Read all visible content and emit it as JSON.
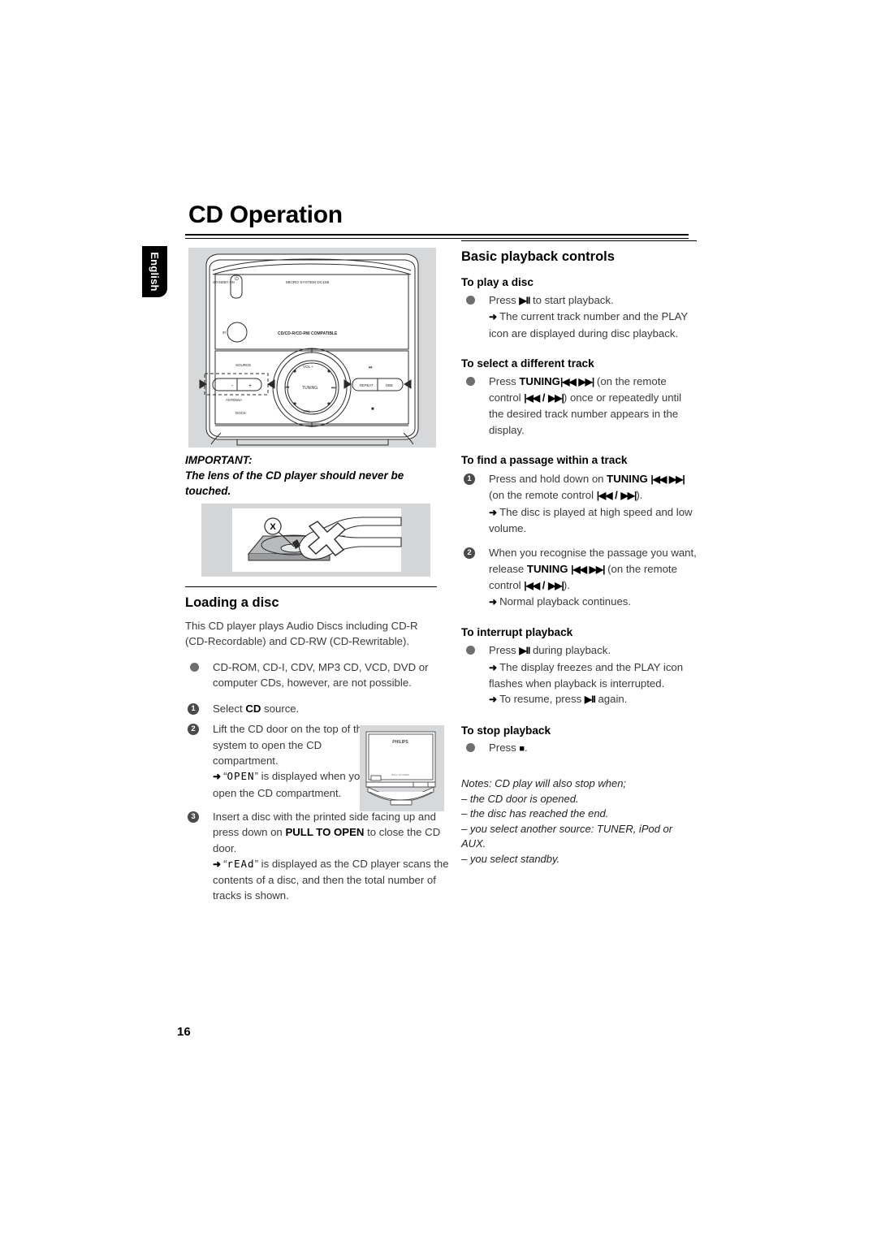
{
  "page": {
    "title": "CD Operation",
    "language_tab": "English",
    "number": "16"
  },
  "device_figure": {
    "name": "micro-system-top-panel",
    "labels": {
      "standby": "STANDBY ON",
      "model": "MICRO SYSTEM DC156",
      "compatible": "CD/CD-R/CD-RW COMPATIBLE",
      "ir": "IR",
      "source": "SOURCE",
      "antenna": "ANTENNA",
      "dock": "DOCK",
      "minus": "-",
      "plus": "+",
      "vol_up": "VOL +",
      "vol_down": "VOL -",
      "tuning": "TUNING",
      "prev": "|◀◀",
      "next": "▶▶|",
      "repeat": "REPEAT",
      "dbb": "DBB",
      "play_pause": "▶II",
      "stop": "■"
    }
  },
  "important": {
    "heading": "IMPORTANT:",
    "text": "The lens of the CD player should never be touched.",
    "figure_label": "X"
  },
  "loading": {
    "heading": "Loading a disc",
    "intro": "This CD player plays Audio Discs including CD-R (CD-Recordable) and CD-RW (CD-Rewritable).",
    "bullet1": "CD-ROM, CD-I, CDV, MP3 CD, VCD, DVD or computer CDs, however, are not possible.",
    "step1_pre": "Select ",
    "step1_bold": "CD",
    "step1_post": " source.",
    "step2_text": "Lift the CD door on the top of the system to open the CD compartment.",
    "step2_result_pre": "“",
    "step2_result_lcd": "OPEN",
    "step2_result_post": "” is displayed when you open the CD compartment.",
    "step3_pre": "Insert a disc with the printed side facing up and press down on ",
    "step3_bold": "PULL TO OPEN",
    "step3_post": " to close the CD door.",
    "step3_result_pre": "“",
    "step3_result_lcd": "rEAd",
    "step3_result_post": "” is displayed as the CD player scans the contents of a disc, and then the total number of tracks is shown.",
    "door_figure_brand": "PHILIPS"
  },
  "basic": {
    "heading": "Basic playback controls",
    "play": {
      "heading": "To play a disc",
      "line_pre": "Press ",
      "glyph": "▶II",
      "line_post": " to start playback.",
      "result": "The current track number and the PLAY icon are displayed during disc playback."
    },
    "select_track": {
      "heading": "To select a different track",
      "pre": "Press ",
      "bold": "TUNING",
      "glyph1": "|◀◀",
      "glyph2": "▶▶|",
      "mid": " (on the remote control ",
      "glyph3": "|◀◀",
      "slash": " / ",
      "glyph4": "▶▶|",
      "post": ") once or repeatedly until the desired track number appears in the display."
    },
    "find_passage": {
      "heading": "To find a passage within a track",
      "step1_pre": "Press and hold down on ",
      "step1_bold": "TUNING",
      "step1_glyph1": "|◀◀",
      "step1_glyph2": "▶▶|",
      "step1_mid": "(on the remote control ",
      "step1_glyph3": "|◀◀",
      "step1_slash": " / ",
      "step1_glyph4": "▶▶|",
      "step1_post": ").",
      "step1_result": "The disc is played at high speed and low volume.",
      "step2_pre": "When you recognise the passage you want, release ",
      "step2_bold": "TUNING",
      "step2_glyph1": "|◀◀",
      "step2_glyph2": "▶▶|",
      "step2_mid": "(on the remote control ",
      "step2_glyph3": "|◀◀",
      "step2_slash": " / ",
      "step2_glyph4": "▶▶|",
      "step2_post": ").",
      "step2_result": "Normal playback continues."
    },
    "interrupt": {
      "heading": "To interrupt playback",
      "pre": "Press ",
      "glyph": "▶II",
      "post": " during playback.",
      "result1": "The display freezes and the PLAY icon flashes when playback is interrupted.",
      "result2_pre": "To resume, press ",
      "result2_glyph": "▶II",
      "result2_post": " again."
    },
    "stop": {
      "heading": "To stop playback",
      "pre": "Press ",
      "glyph": "■",
      "post": "."
    },
    "notes": {
      "lead": "Notes: CD play will also stop when;",
      "items": [
        "– the CD door is opened.",
        "– the disc has reached the end.",
        "– you select another source: TUNER, iPod or AUX.",
        "– you select standby."
      ]
    }
  },
  "colors": {
    "figure_bg": "#d7d8da",
    "text": "#3a3a3c",
    "heading": "#000000",
    "bullet": "#6d6e70",
    "tab_bg": "#000000"
  }
}
